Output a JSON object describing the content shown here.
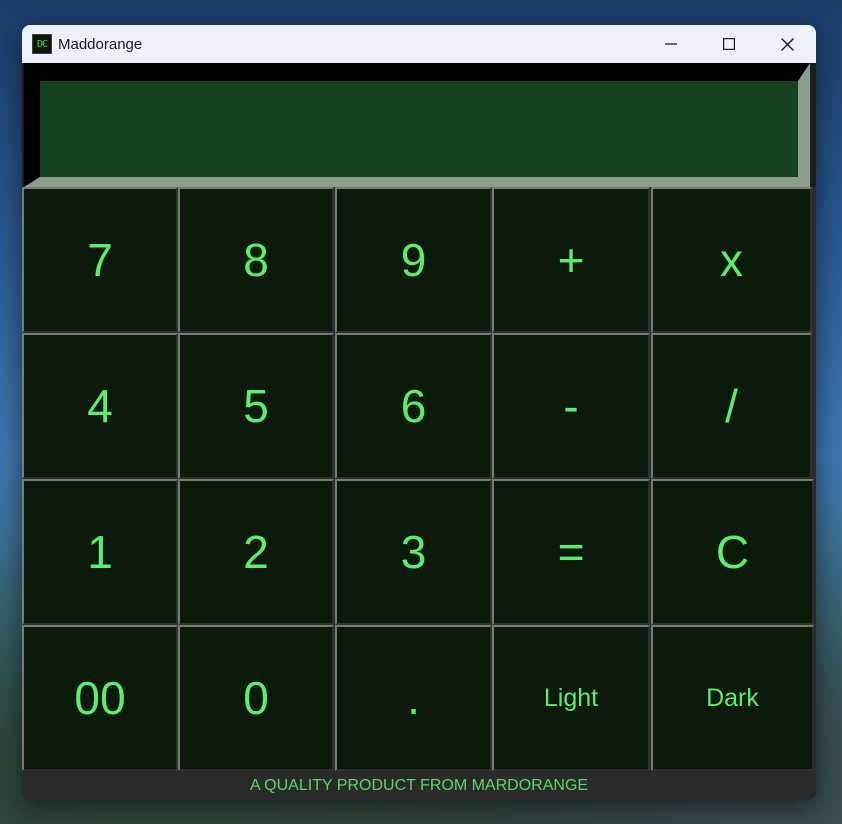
{
  "window": {
    "title": "Maddorange",
    "icon_text": "DC"
  },
  "display": {
    "value": ""
  },
  "keys": {
    "k7": "7",
    "k8": "8",
    "k9": "9",
    "plus": "+",
    "multiply": "x",
    "k4": "4",
    "k5": "5",
    "k6": "6",
    "minus": "-",
    "divide": "/",
    "k1": "1",
    "k2": "2",
    "k3": "3",
    "equals": "=",
    "clear": "C",
    "k00": "00",
    "k0": "0",
    "dot": ".",
    "light": "Light",
    "dark": "Dark"
  },
  "footer": {
    "text": "A QUALITY PRODUCT FROM MARDORANGE"
  },
  "colors": {
    "key_bg": "#0b1a0b",
    "key_text": "#5ced6c",
    "display_bg": "#16411d",
    "titlebar": "#eef2f8"
  }
}
